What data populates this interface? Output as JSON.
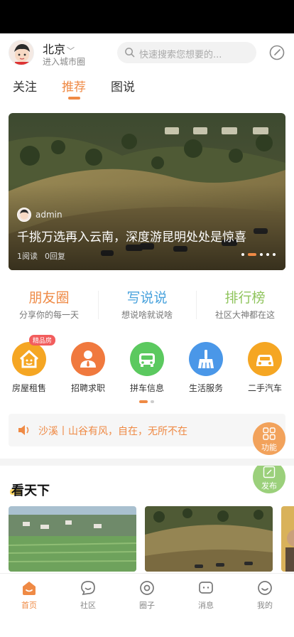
{
  "header": {
    "city": "北京",
    "city_sub": "进入城市圈",
    "search_placeholder": "快速搜索您想要的..."
  },
  "tabs": [
    {
      "label": "关注",
      "active": false
    },
    {
      "label": "推荐",
      "active": true
    },
    {
      "label": "图说",
      "active": false
    }
  ],
  "banner": {
    "author": "admin",
    "title": "千挑万选再入云南，深度游昆明处处是惊喜",
    "reads": "1阅读",
    "replies": "0回复",
    "slide_count": 5,
    "active_slide": 1
  },
  "quick_links": [
    {
      "title": "朋友圈",
      "sub": "分享你的每一天",
      "color": "#ef8a45"
    },
    {
      "title": "写说说",
      "sub": "想说啥就说啥",
      "color": "#4aa3dd"
    },
    {
      "title": "排行榜",
      "sub": "社区大神都在这",
      "color": "#8fc45c"
    }
  ],
  "grid": [
    {
      "label": "房屋租售",
      "icon": "house-icon",
      "color": "#f5a623",
      "badge": "精品房"
    },
    {
      "label": "招聘求职",
      "icon": "job-icon",
      "color": "#f0793e"
    },
    {
      "label": "拼车信息",
      "icon": "car-icon",
      "color": "#5bc95f"
    },
    {
      "label": "生活服务",
      "icon": "broom-icon",
      "color": "#4a97e8"
    },
    {
      "label": "二手汽车",
      "icon": "used-car-icon",
      "color": "#f5a623"
    }
  ],
  "notice": {
    "text": "沙溪丨山谷有风，自在，无所不在"
  },
  "fab": {
    "function_label": "功能",
    "publish_label": "发布"
  },
  "section": {
    "title": "看天下"
  },
  "bottom_nav": [
    {
      "label": "首页",
      "icon": "home-icon",
      "active": true
    },
    {
      "label": "社区",
      "icon": "community-icon",
      "active": false
    },
    {
      "label": "圈子",
      "icon": "circle-icon",
      "active": false
    },
    {
      "label": "消息",
      "icon": "message-icon",
      "active": false
    },
    {
      "label": "我的",
      "icon": "profile-icon",
      "active": false
    }
  ],
  "colors": {
    "accent": "#ef8a45",
    "badge": "#f25d5d"
  }
}
